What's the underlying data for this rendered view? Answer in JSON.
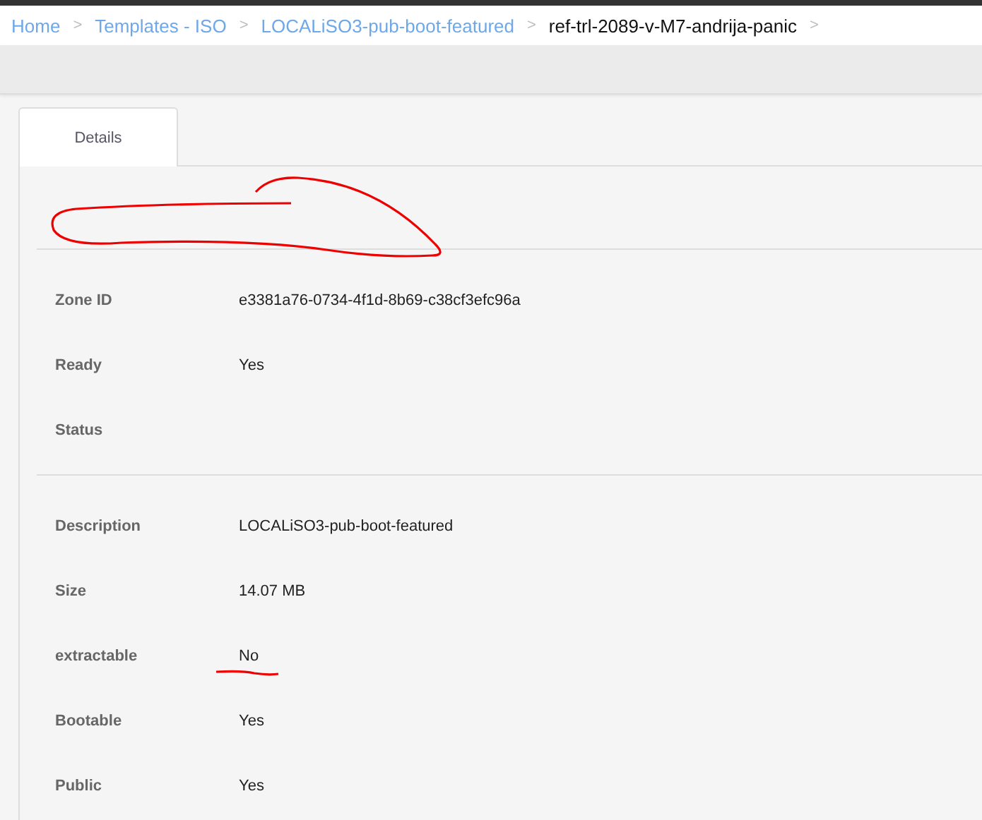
{
  "breadcrumb": [
    {
      "label": "Home",
      "current": false
    },
    {
      "label": "Templates - ISO",
      "current": false
    },
    {
      "label": "LOCALiSO3-pub-boot-featured",
      "current": false
    },
    {
      "label": "ref-trl-2089-v-M7-andrija-panic",
      "current": true
    }
  ],
  "breadcrumb_separator": ">",
  "tabs": [
    {
      "label": "Details",
      "selected": true
    }
  ],
  "sections": [
    [
      {
        "label": "Zone ID",
        "value": "e3381a76-0734-4f1d-8b69-c38cf3efc96a"
      },
      {
        "label": "Ready",
        "value": "Yes"
      },
      {
        "label": "Status"
      }
    ],
    [
      {
        "label": "Description",
        "value": "LOCALiSO3-pub-boot-featured"
      },
      {
        "label": "Size",
        "value": "14.07 MB"
      },
      {
        "label": "extractable",
        "value": "No",
        "underlined": true
      },
      {
        "label": "Bootable",
        "value": "Yes"
      },
      {
        "label": "Public",
        "value": "Yes"
      }
    ]
  ]
}
